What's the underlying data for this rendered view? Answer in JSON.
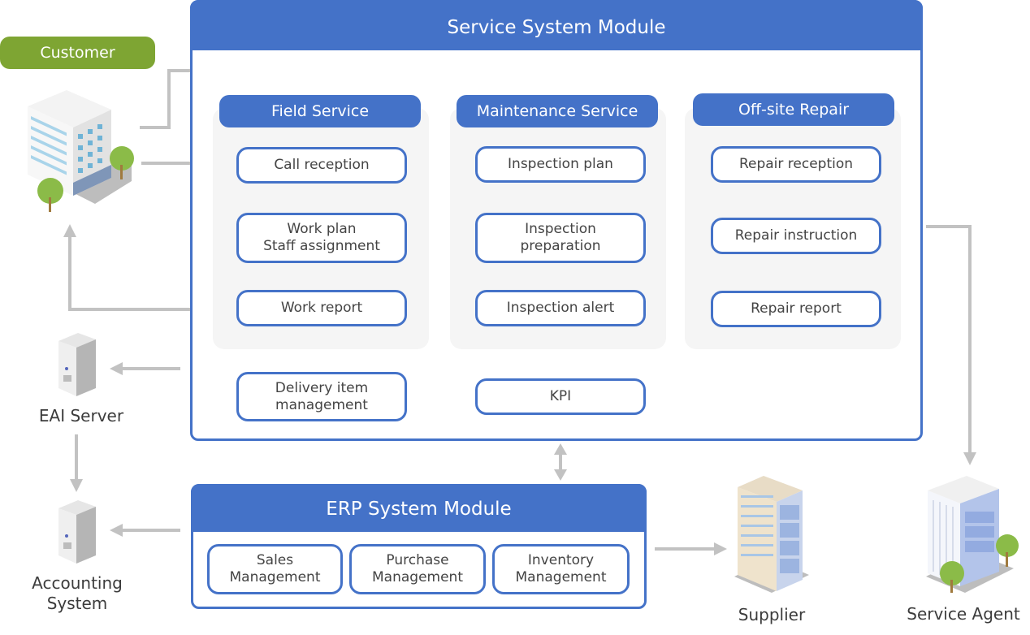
{
  "service_module": {
    "title": "Service System Module",
    "groups": [
      {
        "title": "Field Service",
        "nodes": [
          {
            "lines": [
              "Call reception"
            ]
          },
          {
            "lines": [
              "Work plan",
              "Staff assignment"
            ]
          },
          {
            "lines": [
              "Work report"
            ]
          }
        ]
      },
      {
        "title": "Maintenance Service",
        "nodes": [
          {
            "lines": [
              "Inspection plan"
            ]
          },
          {
            "lines": [
              "Inspection",
              "preparation"
            ]
          },
          {
            "lines": [
              "Inspection alert"
            ]
          }
        ]
      },
      {
        "title": "Off-site Repair",
        "nodes": [
          {
            "lines": [
              "Repair reception"
            ]
          },
          {
            "lines": [
              "Repair instruction"
            ]
          },
          {
            "lines": [
              "Repair report"
            ]
          }
        ]
      }
    ],
    "extra_nodes": [
      {
        "lines": [
          "Delivery item",
          "management"
        ]
      },
      {
        "lines": [
          "KPI"
        ]
      }
    ]
  },
  "erp_module": {
    "title": "ERP System Module",
    "nodes": [
      {
        "lines": [
          "Sales",
          "Management"
        ]
      },
      {
        "lines": [
          "Purchase",
          "Management"
        ]
      },
      {
        "lines": [
          "Inventory",
          "Management"
        ]
      }
    ]
  },
  "entities": {
    "customer": {
      "label": "Customer",
      "icon": "office-building-icon"
    },
    "eai_server": {
      "label": "EAI Server",
      "icon": "server-icon"
    },
    "accounting": {
      "lines": [
        "Accounting",
        "System"
      ],
      "icon": "server-icon"
    },
    "supplier": {
      "label": "Supplier",
      "icon": "office-building-icon"
    },
    "service_agent": {
      "label": "Service Agent",
      "icon": "office-building-icon"
    }
  },
  "colors": {
    "module_blue": "#4472c8",
    "customer_green": "#7ea533",
    "group_bg": "#f5f5f5",
    "connector_gray": "#c2c2c2"
  }
}
